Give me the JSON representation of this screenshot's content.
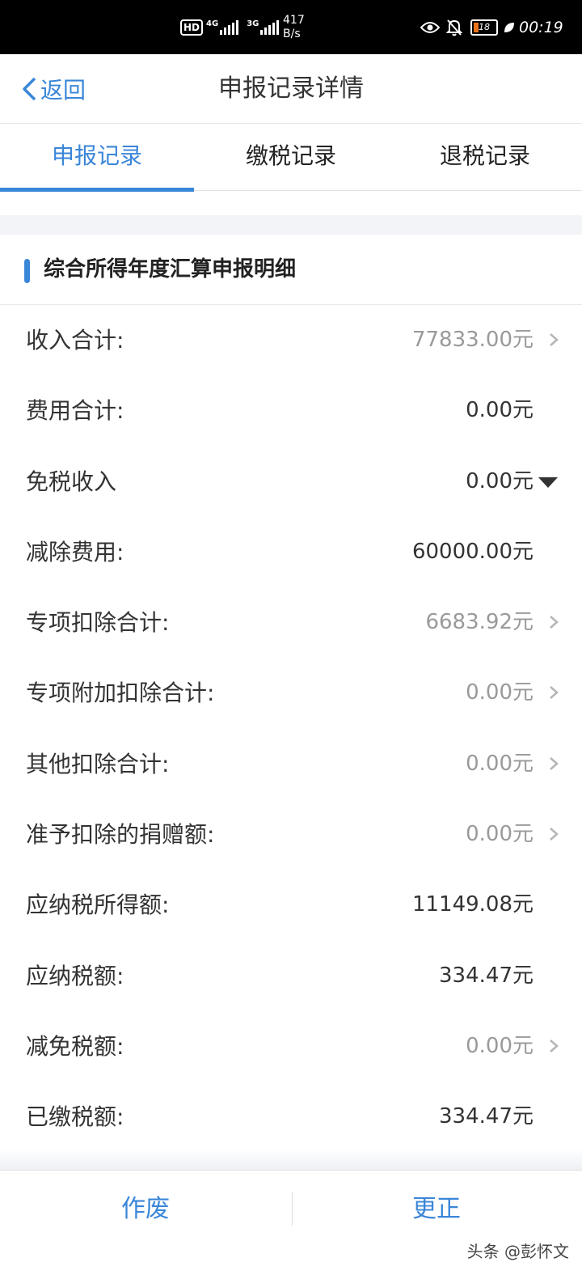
{
  "status_bar": {
    "hd": "HD",
    "net1": "4G",
    "net2": "3G",
    "speed_value": "417",
    "speed_unit": "B/s",
    "battery": "18",
    "time": "00:19"
  },
  "nav": {
    "back_label": "返回",
    "title": "申报记录详情"
  },
  "tabs": [
    {
      "label": "申报记录",
      "active": true
    },
    {
      "label": "缴税记录",
      "active": false
    },
    {
      "label": "退税记录",
      "active": false
    }
  ],
  "section": {
    "title": "综合所得年度汇算申报明细"
  },
  "rows": [
    {
      "label": "收入合计:",
      "value": "77833.00元",
      "indicator": "chevron"
    },
    {
      "label": "费用合计:",
      "value": "0.00元",
      "indicator": "none"
    },
    {
      "label": "免税收入",
      "value": "0.00元",
      "indicator": "dropdown"
    },
    {
      "label": "减除费用:",
      "value": "60000.00元",
      "indicator": "none"
    },
    {
      "label": "专项扣除合计:",
      "value": "6683.92元",
      "indicator": "chevron"
    },
    {
      "label": "专项附加扣除合计:",
      "value": "0.00元",
      "indicator": "chevron"
    },
    {
      "label": "其他扣除合计:",
      "value": "0.00元",
      "indicator": "chevron"
    },
    {
      "label": "准予扣除的捐赠额:",
      "value": "0.00元",
      "indicator": "chevron"
    },
    {
      "label": "应纳税所得额:",
      "value": "11149.08元",
      "indicator": "none"
    },
    {
      "label": "应纳税额:",
      "value": "334.47元",
      "indicator": "none"
    },
    {
      "label": "减免税额:",
      "value": "0.00元",
      "indicator": "chevron"
    },
    {
      "label": "已缴税额:",
      "value": "334.47元",
      "indicator": "none"
    }
  ],
  "actions": {
    "void_label": "作废",
    "correct_label": "更正"
  },
  "watermark": "头条 @彭怀文",
  "colors": {
    "accent": "#3a86d8",
    "value_grey": "#9a9a9a"
  }
}
